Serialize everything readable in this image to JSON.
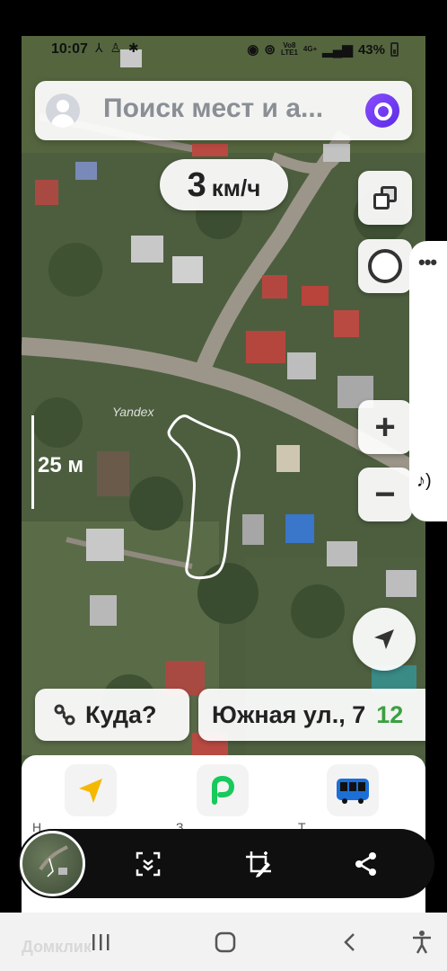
{
  "status_bar": {
    "time": "10:07",
    "net_top": "Vo8",
    "net_bottom": "LTE1",
    "net_type": "4G+",
    "battery": "43%"
  },
  "search": {
    "placeholder": "Поиск мест и а..."
  },
  "speed": {
    "value": "3",
    "unit": "км/ч"
  },
  "map": {
    "scale_label": "25 м",
    "watermark": "Yandex"
  },
  "route_bar": {
    "where_label": "Куда?",
    "address_label": "Южная ул., 7",
    "address_extra": "12"
  },
  "bottom_apps": [
    {
      "name": "navigator",
      "label": "Н"
    },
    {
      "name": "parking",
      "label": "З"
    },
    {
      "name": "transport",
      "label": "Т"
    }
  ],
  "watermark_bottom": "Домклик",
  "colors": {
    "accent_purple": "#7c3aed",
    "navigator_yellow": "#f5b800",
    "parking_green": "#18c95c",
    "transport_blue": "#1c6fd6",
    "address_green": "#3aa040"
  },
  "icons": {
    "layers": "layers-icon",
    "compass": "compass-icon",
    "zoom_in": "plus-icon",
    "zoom_out": "minus-icon",
    "locate": "location-arrow-icon",
    "where": "route-icon",
    "alice": "alice-icon",
    "toolbar": [
      "scroll-capture-icon",
      "crop-edit-icon",
      "share-icon"
    ],
    "nav": [
      "recent-apps-icon",
      "home-icon",
      "back-icon",
      "accessibility-icon"
    ]
  }
}
